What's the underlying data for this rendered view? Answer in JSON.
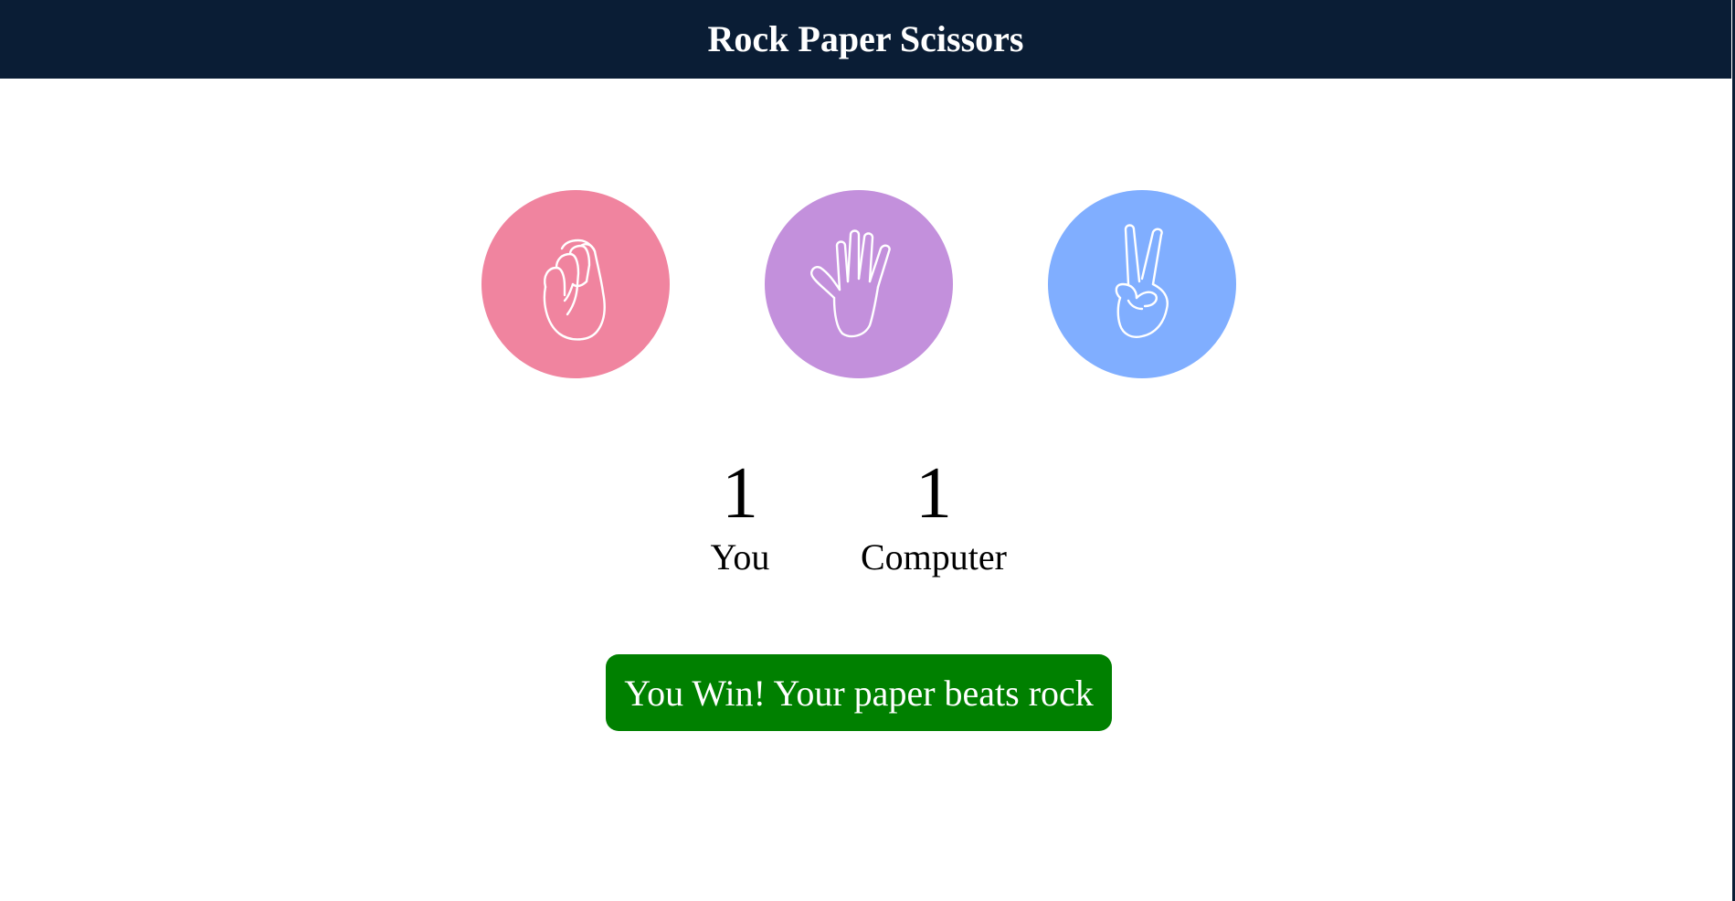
{
  "header": {
    "title": "Rock Paper Scissors"
  },
  "choices": [
    {
      "name": "rock",
      "icon": "fist-icon",
      "color": "#f0849f"
    },
    {
      "name": "paper",
      "icon": "open-hand-icon",
      "color": "#c390dc"
    },
    {
      "name": "scissors",
      "icon": "peace-sign-icon",
      "color": "#80aeff"
    }
  ],
  "scores": {
    "you": {
      "value": "1",
      "label": "You"
    },
    "computer": {
      "value": "1",
      "label": "Computer"
    }
  },
  "result": {
    "message": "You Win! Your paper beats rock",
    "color": "#008000"
  },
  "theme": {
    "header_bg": "#0a1d35",
    "background": "#ffffff"
  }
}
